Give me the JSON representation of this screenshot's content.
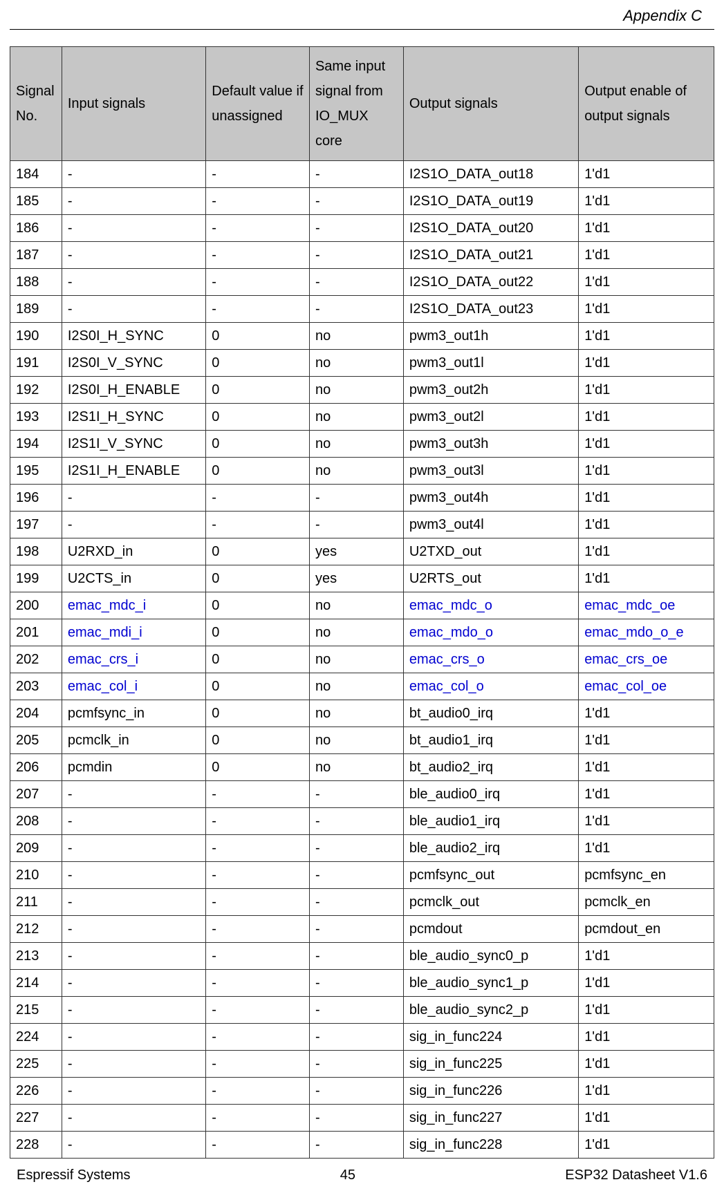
{
  "header": {
    "section": "Appendix C"
  },
  "table": {
    "columns": [
      "Signal No.",
      "Input signals",
      "Default value if unassigned",
      "Same input signal from IO_MUX core",
      "Output signals",
      "Output enable of output signals"
    ],
    "rows": [
      {
        "no": "184",
        "in": "-",
        "def": "-",
        "mux": "-",
        "out": "I2S1O_DATA_out18",
        "oe": "1'd1"
      },
      {
        "no": "185",
        "in": "-",
        "def": "-",
        "mux": "-",
        "out": "I2S1O_DATA_out19",
        "oe": "1'd1"
      },
      {
        "no": "186",
        "in": "-",
        "def": "-",
        "mux": "-",
        "out": "I2S1O_DATA_out20",
        "oe": "1'd1"
      },
      {
        "no": "187",
        "in": "-",
        "def": "-",
        "mux": "-",
        "out": "I2S1O_DATA_out21",
        "oe": "1'd1"
      },
      {
        "no": "188",
        "in": "-",
        "def": "-",
        "mux": "-",
        "out": "I2S1O_DATA_out22",
        "oe": "1'd1"
      },
      {
        "no": "189",
        "in": "-",
        "def": "-",
        "mux": "-",
        "out": "I2S1O_DATA_out23",
        "oe": "1'd1"
      },
      {
        "no": "190",
        "in": "I2S0I_H_SYNC",
        "def": "0",
        "mux": "no",
        "out": "pwm3_out1h",
        "oe": "1'd1"
      },
      {
        "no": "191",
        "in": "I2S0I_V_SYNC",
        "def": "0",
        "mux": "no",
        "out": "pwm3_out1l",
        "oe": "1'd1"
      },
      {
        "no": "192",
        "in": "I2S0I_H_ENABLE",
        "def": "0",
        "mux": "no",
        "out": "pwm3_out2h",
        "oe": "1'd1"
      },
      {
        "no": "193",
        "in": "I2S1I_H_SYNC",
        "def": "0",
        "mux": "no",
        "out": "pwm3_out2l",
        "oe": "1'd1"
      },
      {
        "no": "194",
        "in": "I2S1I_V_SYNC",
        "def": "0",
        "mux": "no",
        "out": "pwm3_out3h",
        "oe": "1'd1"
      },
      {
        "no": "195",
        "in": "I2S1I_H_ENABLE",
        "def": "0",
        "mux": "no",
        "out": "pwm3_out3l",
        "oe": "1'd1"
      },
      {
        "no": "196",
        "in": "-",
        "def": "-",
        "mux": "-",
        "out": "pwm3_out4h",
        "oe": "1'd1"
      },
      {
        "no": "197",
        "in": "-",
        "def": "-",
        "mux": "-",
        "out": "pwm3_out4l",
        "oe": "1'd1"
      },
      {
        "no": "198",
        "in": "U2RXD_in",
        "def": "0",
        "mux": "yes",
        "out": "U2TXD_out",
        "oe": "1'd1"
      },
      {
        "no": "199",
        "in": "U2CTS_in",
        "def": "0",
        "mux": "yes",
        "out": "U2RTS_out",
        "oe": "1'd1"
      },
      {
        "no": "200",
        "in": "emac_mdc_i",
        "in_link": true,
        "def": "0",
        "mux": "no",
        "out": "emac_mdc_o",
        "out_link": true,
        "oe": "emac_mdc_oe",
        "oe_link": true
      },
      {
        "no": "201",
        "in": "emac_mdi_i",
        "in_link": true,
        "def": "0",
        "mux": "no",
        "out": "emac_mdo_o",
        "out_link": true,
        "oe": "emac_mdo_o_e",
        "oe_link": true
      },
      {
        "no": "202",
        "in": "emac_crs_i",
        "in_link": true,
        "def": "0",
        "mux": "no",
        "out": "emac_crs_o",
        "out_link": true,
        "oe": "emac_crs_oe",
        "oe_link": true
      },
      {
        "no": "203",
        "in": "emac_col_i",
        "in_link": true,
        "def": "0",
        "mux": "no",
        "out": "emac_col_o",
        "out_link": true,
        "oe": "emac_col_oe",
        "oe_link": true
      },
      {
        "no": "204",
        "in": "pcmfsync_in",
        "def": "0",
        "mux": "no",
        "out": "bt_audio0_irq",
        "oe": "1'd1"
      },
      {
        "no": "205",
        "in": "pcmclk_in",
        "def": "0",
        "mux": "no",
        "out": "bt_audio1_irq",
        "oe": "1'd1"
      },
      {
        "no": "206",
        "in": "pcmdin",
        "def": "0",
        "mux": "no",
        "out": "bt_audio2_irq",
        "oe": "1'd1"
      },
      {
        "no": "207",
        "in": "-",
        "def": "-",
        "mux": "-",
        "out": "ble_audio0_irq",
        "oe": "1'd1"
      },
      {
        "no": "208",
        "in": "-",
        "def": "-",
        "mux": "-",
        "out": "ble_audio1_irq",
        "oe": "1'd1"
      },
      {
        "no": "209",
        "in": "-",
        "def": "-",
        "mux": "-",
        "out": "ble_audio2_irq",
        "oe": "1'd1"
      },
      {
        "no": "210",
        "in": "-",
        "def": "-",
        "mux": "-",
        "out": "pcmfsync_out",
        "oe": "pcmfsync_en"
      },
      {
        "no": "211",
        "in": "-",
        "def": "-",
        "mux": "-",
        "out": "pcmclk_out",
        "oe": "pcmclk_en"
      },
      {
        "no": "212",
        "in": "-",
        "def": "-",
        "mux": "-",
        "out": "pcmdout",
        "oe": "pcmdout_en"
      },
      {
        "no": "213",
        "in": "-",
        "def": "-",
        "mux": "-",
        "out": "ble_audio_sync0_p",
        "oe": "1'd1"
      },
      {
        "no": "214",
        "in": "-",
        "def": "-",
        "mux": "-",
        "out": "ble_audio_sync1_p",
        "oe": "1'd1"
      },
      {
        "no": "215",
        "in": "-",
        "def": "-",
        "mux": "-",
        "out": "ble_audio_sync2_p",
        "oe": "1'd1"
      },
      {
        "no": "224",
        "in": "-",
        "def": "-",
        "mux": "-",
        "out": "sig_in_func224",
        "oe": "1'd1"
      },
      {
        "no": "225",
        "in": "-",
        "def": "-",
        "mux": "-",
        "out": "sig_in_func225",
        "oe": "1'd1"
      },
      {
        "no": "226",
        "in": "-",
        "def": "-",
        "mux": "-",
        "out": "sig_in_func226",
        "oe": "1'd1"
      },
      {
        "no": "227",
        "in": "-",
        "def": "-",
        "mux": "-",
        "out": "sig_in_func227",
        "oe": "1'd1"
      },
      {
        "no": "228",
        "in": "-",
        "def": "-",
        "mux": "-",
        "out": "sig_in_func228",
        "oe": "1'd1"
      }
    ]
  },
  "footer": {
    "left": "Espressif Systems",
    "center": "45",
    "right": "ESP32 Datasheet V1.6"
  }
}
